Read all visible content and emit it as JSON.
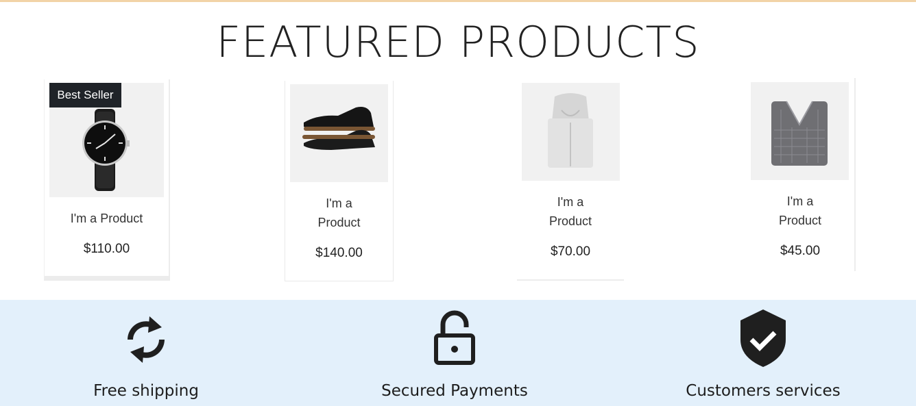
{
  "section": {
    "title": "FEATURED PRODUCTS"
  },
  "products": [
    {
      "name": "I'm a Product",
      "price": "$110.00",
      "badge": "Best Seller"
    },
    {
      "name": "I'm a Product",
      "price": "$140.00"
    },
    {
      "name": "I'm a Product",
      "price": "$70.00"
    },
    {
      "name": "I'm a Product",
      "price": "$45.00"
    }
  ],
  "features": [
    {
      "label": "Free shipping",
      "icon": "refresh-icon"
    },
    {
      "label": "Secured Payments",
      "icon": "padlock-icon"
    },
    {
      "label": "Customers services",
      "icon": "shield-check-icon"
    }
  ],
  "colors": {
    "features_bg": "#e3f0fb",
    "badge_bg": "#1f2328",
    "top_rule": "#f2d3a7"
  }
}
